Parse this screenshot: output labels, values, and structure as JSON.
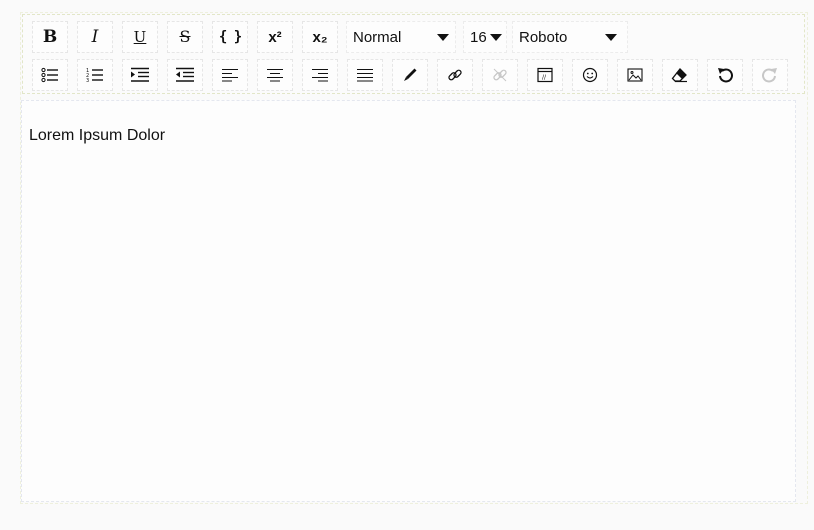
{
  "toolbar": {
    "row1": [
      {
        "name": "bold-button",
        "icon": "bold-icon",
        "glyph": "B"
      },
      {
        "name": "italic-button",
        "icon": "italic-icon",
        "glyph": "I"
      },
      {
        "name": "underline-button",
        "icon": "underline-icon",
        "glyph": "U"
      },
      {
        "name": "strikethrough-button",
        "icon": "strikethrough-icon",
        "glyph": "S"
      },
      {
        "name": "code-button",
        "icon": "code-braces-icon",
        "glyph": "{ }"
      },
      {
        "name": "superscript-button",
        "icon": "superscript-icon",
        "glyph": "x²"
      },
      {
        "name": "subscript-button",
        "icon": "subscript-icon",
        "glyph": "x₂"
      }
    ],
    "block_type": {
      "value": "Normal"
    },
    "font_size": {
      "value": "16"
    },
    "font_family": {
      "value": "Roboto"
    },
    "row2_icons": [
      "unordered-list-icon",
      "ordered-list-icon",
      "indent-icon",
      "outdent-icon",
      "align-left-icon",
      "align-center-icon",
      "align-right-icon",
      "align-justify-icon",
      "color-picker-icon",
      "link-icon",
      "unlink-icon",
      "embed-icon",
      "emoji-icon",
      "image-icon",
      "eraser-icon",
      "undo-icon",
      "redo-icon"
    ]
  },
  "editor": {
    "content": "Lorem Ipsum Dolor"
  },
  "colors": {
    "icon": "#111111",
    "disabled": "#c7c7c7",
    "border": "#e6e6e6"
  }
}
